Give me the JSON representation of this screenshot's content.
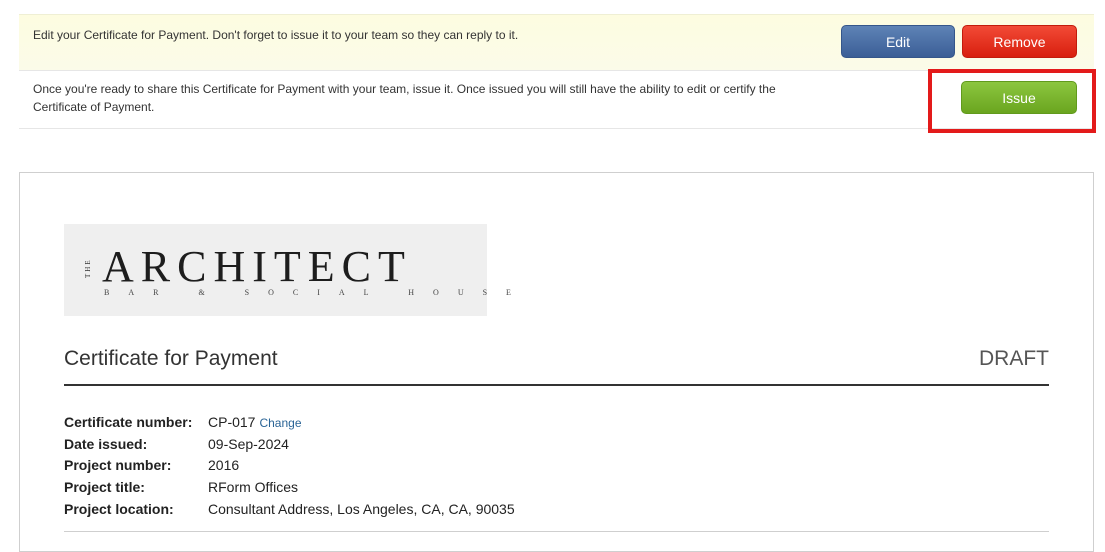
{
  "edit_bar": {
    "message": "Edit your Certificate for Payment. Don't forget to issue it to your team so they can reply to it.",
    "edit_label": "Edit",
    "remove_label": "Remove"
  },
  "issue_bar": {
    "message": "Once you're ready to share this Certificate for Payment with your team, issue it. Once issued you will still have the ability to edit or certify the Certificate of Payment.",
    "issue_label": "Issue"
  },
  "logo": {
    "the": "THE",
    "main": "ARCHITECT",
    "sub": "BAR & SOCIAL HOUSE"
  },
  "document": {
    "title": "Certificate for Payment",
    "status": "DRAFT",
    "fields": [
      {
        "label": "Certificate number:",
        "value": "CP-017",
        "link": "Change"
      },
      {
        "label": "Date issued:",
        "value": "09-Sep-2024"
      },
      {
        "label": "Project number:",
        "value": "2016"
      },
      {
        "label": "Project title:",
        "value": "RForm Offices"
      },
      {
        "label": "Project location:",
        "value": "Consultant Address, Los Angeles, CA, CA, 90035"
      }
    ]
  },
  "colors": {
    "edit_button": "#4a6fa5",
    "remove_button": "#e8351f",
    "issue_button": "#7bb62d",
    "highlight": "#e31a1a"
  }
}
